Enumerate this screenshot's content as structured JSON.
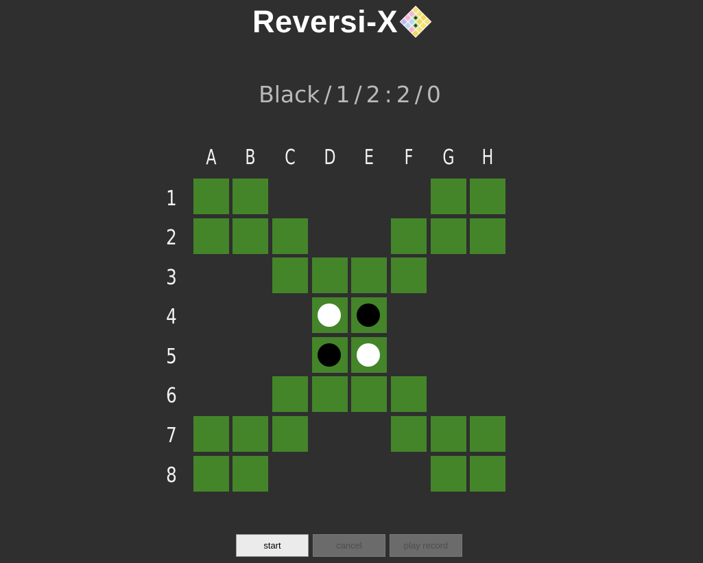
{
  "app": {
    "title": "Reversi-X"
  },
  "status": {
    "turn": "Black",
    "move": "1",
    "black_count": "2",
    "white_count": "2",
    "passes": "0"
  },
  "board": {
    "columns": [
      "A",
      "B",
      "C",
      "D",
      "E",
      "F",
      "G",
      "H"
    ],
    "rows": [
      "1",
      "2",
      "3",
      "4",
      "5",
      "6",
      "7",
      "8"
    ],
    "playable": [
      "11000011",
      "11100111",
      "00111100",
      "00011000",
      "00011000",
      "00111100",
      "11100111",
      "11000011"
    ],
    "discs": [
      "........",
      "........",
      "........",
      "...WB...",
      "...BW...",
      "........",
      "........",
      "........"
    ]
  },
  "colors": {
    "background": "#2f2f2f",
    "cell": "#44852a",
    "status_text": "#b9b9b9"
  },
  "buttons": {
    "start": "start",
    "cancel": "cancel",
    "play_record": "play record"
  }
}
